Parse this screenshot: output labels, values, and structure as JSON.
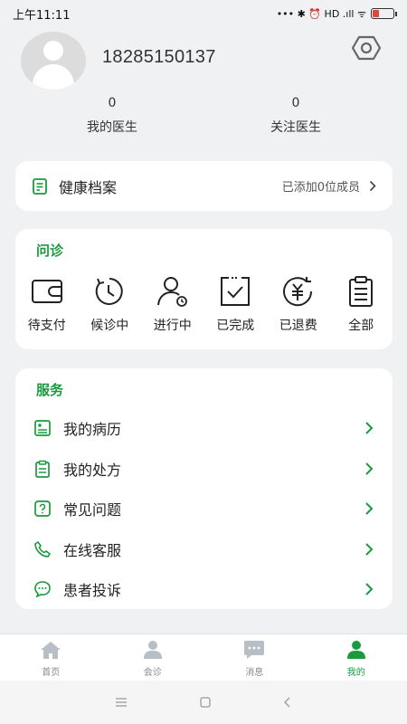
{
  "status_bar": {
    "time": "上午11:11",
    "indicators": "••• ✱ ⏰ HD .ıll ᯤ"
  },
  "profile": {
    "phone": "18285150137",
    "stats": [
      {
        "value": "0",
        "label": "我的医生"
      },
      {
        "value": "0",
        "label": "关注医生"
      }
    ]
  },
  "health": {
    "title": "健康档案",
    "subtitle": "已添加0位成员"
  },
  "consult": {
    "title": "问诊",
    "items": [
      {
        "label": "待支付",
        "icon": "wallet-icon"
      },
      {
        "label": "候诊中",
        "icon": "clock-icon"
      },
      {
        "label": "进行中",
        "icon": "user-progress-icon"
      },
      {
        "label": "已完成",
        "icon": "check-box-icon"
      },
      {
        "label": "已退费",
        "icon": "yuan-refund-icon"
      },
      {
        "label": "全部",
        "icon": "clipboard-icon"
      }
    ]
  },
  "service": {
    "title": "服务",
    "items": [
      {
        "label": "我的病历",
        "icon": "medical-record-icon"
      },
      {
        "label": "我的处方",
        "icon": "prescription-icon"
      },
      {
        "label": "常见问题",
        "icon": "question-icon"
      },
      {
        "label": "在线客服",
        "icon": "phone-icon"
      },
      {
        "label": "患者投诉",
        "icon": "chat-icon"
      }
    ]
  },
  "nav": {
    "items": [
      {
        "label": "首页",
        "icon": "home-icon"
      },
      {
        "label": "会诊",
        "icon": "consultation-icon"
      },
      {
        "label": "消息",
        "icon": "message-icon"
      },
      {
        "label": "我的",
        "icon": "profile-icon"
      }
    ]
  },
  "colors": {
    "accent": "#1a9a3e",
    "background": "#f0f1f3",
    "card": "#ffffff",
    "inactive": "#b8bec6"
  }
}
